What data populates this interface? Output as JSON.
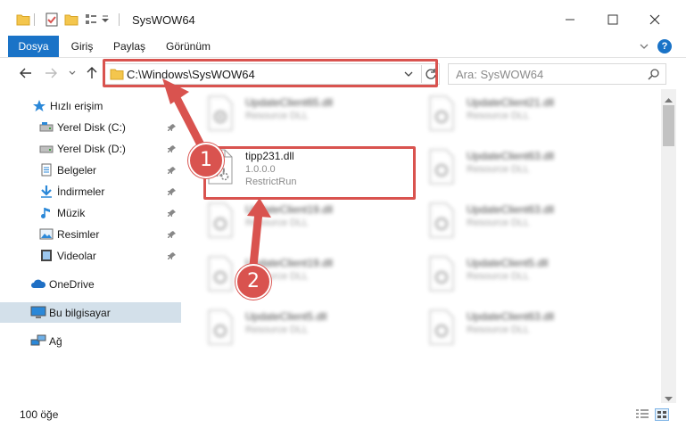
{
  "window": {
    "title": "SysWOW64",
    "minimize_glyph": "—",
    "maximize_glyph": "☐",
    "close_glyph": "✕"
  },
  "ribbon": {
    "tabs": [
      "Dosya",
      "Giriş",
      "Paylaş",
      "Görünüm"
    ],
    "help_glyph": "?"
  },
  "address_bar": {
    "path": "C:\\Windows\\SysWOW64",
    "search_placeholder": "Ara: SysWOW64"
  },
  "sidebar": {
    "items": [
      {
        "label": "Hızlı erişim",
        "icon": "star-icon",
        "pinned": false
      },
      {
        "label": "Yerel Disk (C:)",
        "icon": "drive-icon",
        "pinned": true
      },
      {
        "label": "Yerel Disk (D:)",
        "icon": "drive-icon",
        "pinned": true
      },
      {
        "label": "Belgeler",
        "icon": "documents-icon",
        "pinned": true
      },
      {
        "label": "İndirmeler",
        "icon": "download-icon",
        "pinned": true
      },
      {
        "label": "Müzik",
        "icon": "music-icon",
        "pinned": true
      },
      {
        "label": "Resimler",
        "icon": "pictures-icon",
        "pinned": true
      },
      {
        "label": "Videolar",
        "icon": "videos-icon",
        "pinned": true
      },
      {
        "label": "OneDrive",
        "icon": "cloud-icon",
        "pinned": false
      },
      {
        "label": "Bu bilgisayar",
        "icon": "computer-icon",
        "pinned": false,
        "selected": true
      },
      {
        "label": "Ağ",
        "icon": "network-icon",
        "pinned": false
      }
    ]
  },
  "files": {
    "left_column": [
      {
        "name": "UpdateClient65.dll",
        "line1": "Resource DLL",
        "line2": "",
        "blurred": true
      },
      {
        "name": "tipp231.dll",
        "line1": "1.0.0.0",
        "line2": "RestrictRun",
        "blurred": false
      },
      {
        "name": "UpdateClient19.dll",
        "line1": "Resource DLL",
        "line2": "",
        "blurred": true
      },
      {
        "name": "UpdateClient19.dll",
        "line1": "Resource DLL",
        "line2": "",
        "blurred": true
      },
      {
        "name": "UpdateClient5.dll",
        "line1": "Resource DLL",
        "line2": "",
        "blurred": true
      }
    ],
    "right_column": [
      {
        "name": "UpdateClient21.dll",
        "line1": "Resource DLL",
        "line2": "",
        "blurred": true
      },
      {
        "name": "UpdateClient63.dll",
        "line1": "Resource DLL",
        "line2": "",
        "blurred": true
      },
      {
        "name": "UpdateClient63.dll",
        "line1": "Resource DLL",
        "line2": "",
        "blurred": true
      },
      {
        "name": "UpdateClient5.dll",
        "line1": "Resource DLL",
        "line2": "",
        "blurred": true
      },
      {
        "name": "UpdateClient63.dll",
        "line1": "Resource DLL",
        "line2": "",
        "blurred": true
      }
    ]
  },
  "status": {
    "item_count": "100 öğe"
  },
  "callouts": [
    "1",
    "2"
  ],
  "colors": {
    "accent": "#1a73c7",
    "highlight": "#d9534f",
    "selected": "#cce8ff"
  }
}
